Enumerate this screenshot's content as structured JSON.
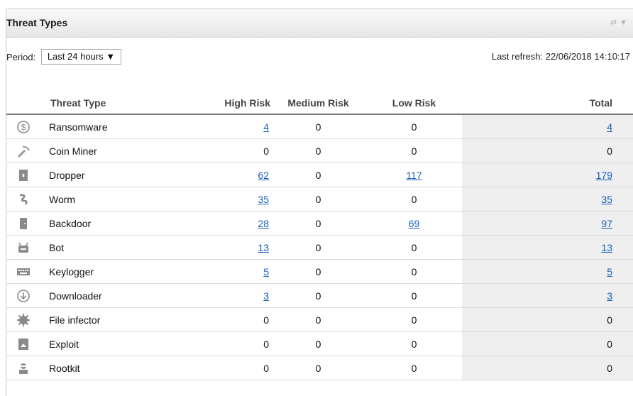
{
  "widget": {
    "title": "Threat Types",
    "period_label": "Period:",
    "period_value": "Last 24 hours ▼",
    "last_refresh": "Last refresh: 22/06/2018 14:10:17"
  },
  "table": {
    "headers": [
      "Threat Type",
      "High Risk",
      "Medium Risk",
      "Low Risk",
      "Total"
    ],
    "rows": [
      {
        "icon": "ransomware-icon",
        "name": "Ransomware",
        "high": "4",
        "high_link": true,
        "medium": "0",
        "low": "0",
        "low_link": false,
        "total": "4",
        "total_link": true
      },
      {
        "icon": "coin-miner-icon",
        "name": "Coin Miner",
        "high": "0",
        "high_link": false,
        "medium": "0",
        "low": "0",
        "low_link": false,
        "total": "0",
        "total_link": false
      },
      {
        "icon": "dropper-icon",
        "name": "Dropper",
        "high": "62",
        "high_link": true,
        "medium": "0",
        "low": "117",
        "low_link": true,
        "total": "179",
        "total_link": true
      },
      {
        "icon": "worm-icon",
        "name": "Worm",
        "high": "35",
        "high_link": true,
        "medium": "0",
        "low": "0",
        "low_link": false,
        "total": "35",
        "total_link": true
      },
      {
        "icon": "backdoor-icon",
        "name": "Backdoor",
        "high": "28",
        "high_link": true,
        "medium": "0",
        "low": "69",
        "low_link": true,
        "total": "97",
        "total_link": true
      },
      {
        "icon": "bot-icon",
        "name": "Bot",
        "high": "13",
        "high_link": true,
        "medium": "0",
        "low": "0",
        "low_link": false,
        "total": "13",
        "total_link": true
      },
      {
        "icon": "keylogger-icon",
        "name": "Keylogger",
        "high": "5",
        "high_link": true,
        "medium": "0",
        "low": "0",
        "low_link": false,
        "total": "5",
        "total_link": true
      },
      {
        "icon": "downloader-icon",
        "name": "Downloader",
        "high": "3",
        "high_link": true,
        "medium": "0",
        "low": "0",
        "low_link": false,
        "total": "3",
        "total_link": true
      },
      {
        "icon": "file-infector-icon",
        "name": "File infector",
        "high": "0",
        "high_link": false,
        "medium": "0",
        "low": "0",
        "low_link": false,
        "total": "0",
        "total_link": false
      },
      {
        "icon": "exploit-icon",
        "name": "Exploit",
        "high": "0",
        "high_link": false,
        "medium": "0",
        "low": "0",
        "low_link": false,
        "total": "0",
        "total_link": false
      },
      {
        "icon": "rootkit-icon",
        "name": "Rootkit",
        "high": "0",
        "high_link": false,
        "medium": "0",
        "low": "0",
        "low_link": false,
        "total": "0",
        "total_link": false
      }
    ]
  },
  "colors": {
    "link": "#1a5fb4",
    "total_bg": "#efefef",
    "icon": "#8a8a8a"
  }
}
